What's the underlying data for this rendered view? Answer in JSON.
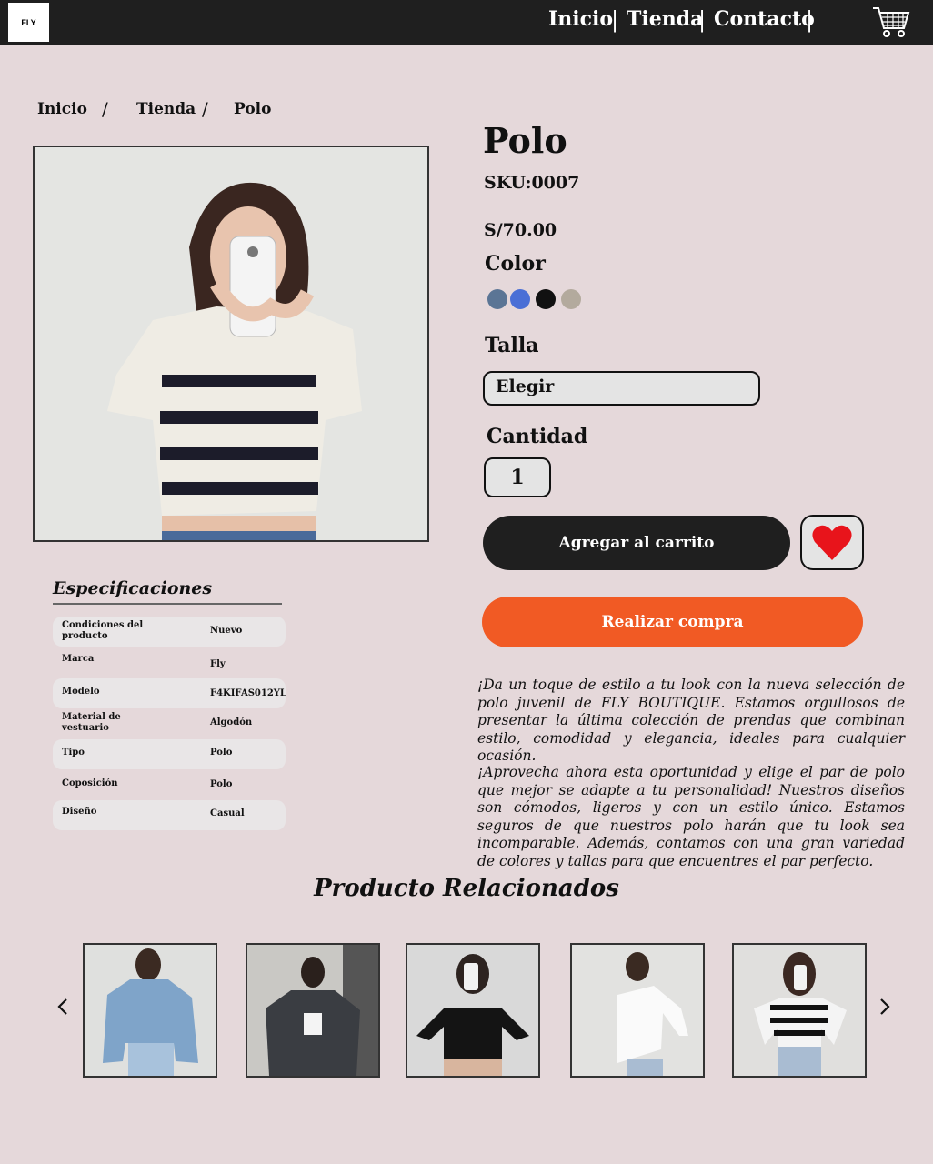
{
  "header": {
    "logo_text": "FLY",
    "nav": [
      "Inicio",
      "Tienda",
      "Contacto"
    ],
    "separator": "|",
    "cart_icon": "shopping-cart-icon"
  },
  "breadcrumb": {
    "items": [
      "Inicio",
      "Tienda",
      "Polo"
    ],
    "separator": "/"
  },
  "product": {
    "title": "Polo",
    "sku": "SKU:0007",
    "price": "S/70.00",
    "color_label": "Color",
    "colors": [
      "#5b7595",
      "#4a6fd6",
      "#111111",
      "#b3aa9d"
    ],
    "size_label": "Talla",
    "size_value": "Elegir",
    "qty_label": "Cantidad",
    "qty_value": "1",
    "add_to_cart": "Agregar al carrito",
    "buy": "Realizar compra",
    "favorite_icon": "heart-icon",
    "accent_colors": {
      "dark": "#1f1f1f",
      "buy": "#f15a24",
      "heart": "#e8141b"
    }
  },
  "specs": {
    "title": "Especificaciones",
    "rows": [
      {
        "key": "Condiciones del producto",
        "value": "Nuevo"
      },
      {
        "key": "Marca",
        "value": "Fly"
      },
      {
        "key": "Modelo",
        "value": "F4KIFAS012YL"
      },
      {
        "key": "Material de vestuario",
        "value": "Algodón"
      },
      {
        "key": "Tipo",
        "value": "Polo"
      },
      {
        "key": "Coposición",
        "value": "Polo"
      },
      {
        "key": "Diseño",
        "value": "Casual"
      }
    ]
  },
  "description": {
    "p1": "¡Da un toque de estilo a tu look con la nueva selección de polo juvenil de FLY BOUTIQUE. Estamos orgullosos de presentar la última colección de prendas que combinan estilo, comodidad y elegancia, ideales para cualquier ocasión.",
    "p2": "¡Aprovecha ahora esta oportunidad y elige el par de polo que mejor se adapte a tu personalidad! Nuestros diseños son cómodos, ligeros y con un estilo único. Estamos seguros de que nuestros polo harán que tu look sea incomparable. Además, contamos con una gran variedad de colores y tallas para que encuentres el par perfecto."
  },
  "related": {
    "title": "Producto Relacionados",
    "prev_icon": "chevron-left-icon",
    "next_icon": "chevron-right-icon",
    "items": [
      "denim-jacket-photo",
      "black-denim-jacket-photo",
      "black-cutout-top-photo",
      "white-asymmetric-top-photo",
      "striped-long-sleeve-top-photo"
    ]
  }
}
